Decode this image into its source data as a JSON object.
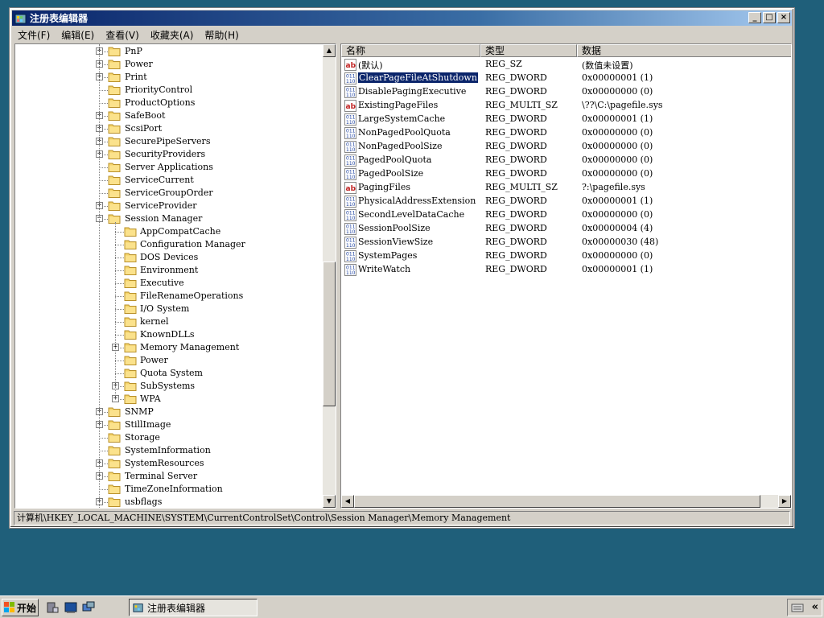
{
  "window": {
    "title": "注册表编辑器"
  },
  "title_buttons": {
    "minimize": "_",
    "maximize": "□",
    "close": "×"
  },
  "menu": [
    "文件(F)",
    "编辑(E)",
    "查看(V)",
    "收藏夹(A)",
    "帮助(H)"
  ],
  "tree": {
    "items": [
      {
        "label": "PnP",
        "expandable": true,
        "level": 0
      },
      {
        "label": "Power",
        "expandable": true,
        "level": 0
      },
      {
        "label": "Print",
        "expandable": true,
        "level": 0
      },
      {
        "label": "PriorityControl",
        "expandable": false,
        "level": 0
      },
      {
        "label": "ProductOptions",
        "expandable": false,
        "level": 0
      },
      {
        "label": "SafeBoot",
        "expandable": true,
        "level": 0
      },
      {
        "label": "ScsiPort",
        "expandable": true,
        "level": 0
      },
      {
        "label": "SecurePipeServers",
        "expandable": true,
        "level": 0
      },
      {
        "label": "SecurityProviders",
        "expandable": true,
        "level": 0
      },
      {
        "label": "Server Applications",
        "expandable": false,
        "level": 0
      },
      {
        "label": "ServiceCurrent",
        "expandable": false,
        "level": 0
      },
      {
        "label": "ServiceGroupOrder",
        "expandable": false,
        "level": 0
      },
      {
        "label": "ServiceProvider",
        "expandable": true,
        "level": 0
      },
      {
        "label": "Session Manager",
        "expandable": true,
        "expanded": true,
        "level": 0
      },
      {
        "label": "AppCompatCache",
        "expandable": false,
        "level": 1
      },
      {
        "label": "Configuration Manager",
        "expandable": false,
        "level": 1
      },
      {
        "label": "DOS Devices",
        "expandable": false,
        "level": 1
      },
      {
        "label": "Environment",
        "expandable": false,
        "level": 1
      },
      {
        "label": "Executive",
        "expandable": false,
        "level": 1
      },
      {
        "label": "FileRenameOperations",
        "expandable": false,
        "level": 1
      },
      {
        "label": "I/O System",
        "expandable": false,
        "level": 1
      },
      {
        "label": "kernel",
        "expandable": false,
        "level": 1
      },
      {
        "label": "KnownDLLs",
        "expandable": false,
        "level": 1
      },
      {
        "label": "Memory Management",
        "expandable": true,
        "level": 1
      },
      {
        "label": "Power",
        "expandable": false,
        "level": 1
      },
      {
        "label": "Quota System",
        "expandable": false,
        "level": 1
      },
      {
        "label": "SubSystems",
        "expandable": true,
        "level": 1
      },
      {
        "label": "WPA",
        "expandable": true,
        "level": 1
      },
      {
        "label": "SNMP",
        "expandable": true,
        "level": 0
      },
      {
        "label": "StillImage",
        "expandable": true,
        "level": 0
      },
      {
        "label": "Storage",
        "expandable": false,
        "level": 0
      },
      {
        "label": "SystemInformation",
        "expandable": false,
        "level": 0
      },
      {
        "label": "SystemResources",
        "expandable": true,
        "level": 0
      },
      {
        "label": "Terminal Server",
        "expandable": true,
        "level": 0
      },
      {
        "label": "TimeZoneInformation",
        "expandable": false,
        "level": 0
      },
      {
        "label": "usbflags",
        "expandable": true,
        "level": 0
      }
    ]
  },
  "values": {
    "columns": [
      "名称",
      "类型",
      "数据"
    ],
    "rows": [
      {
        "icon": "string-icon",
        "name": "(默认)",
        "type": "REG_SZ",
        "data": "(数值未设置)"
      },
      {
        "icon": "binary-icon",
        "name": "ClearPageFileAtShutdown",
        "type": "REG_DWORD",
        "data": "0x00000001 (1)",
        "selected": true
      },
      {
        "icon": "binary-icon",
        "name": "DisablePagingExecutive",
        "type": "REG_DWORD",
        "data": "0x00000000 (0)"
      },
      {
        "icon": "string-icon",
        "name": "ExistingPageFiles",
        "type": "REG_MULTI_SZ",
        "data": "\\??\\C:\\pagefile.sys"
      },
      {
        "icon": "binary-icon",
        "name": "LargeSystemCache",
        "type": "REG_DWORD",
        "data": "0x00000001 (1)"
      },
      {
        "icon": "binary-icon",
        "name": "NonPagedPoolQuota",
        "type": "REG_DWORD",
        "data": "0x00000000 (0)"
      },
      {
        "icon": "binary-icon",
        "name": "NonPagedPoolSize",
        "type": "REG_DWORD",
        "data": "0x00000000 (0)"
      },
      {
        "icon": "binary-icon",
        "name": "PagedPoolQuota",
        "type": "REG_DWORD",
        "data": "0x00000000 (0)"
      },
      {
        "icon": "binary-icon",
        "name": "PagedPoolSize",
        "type": "REG_DWORD",
        "data": "0x00000000 (0)"
      },
      {
        "icon": "string-icon",
        "name": "PagingFiles",
        "type": "REG_MULTI_SZ",
        "data": "?:\\pagefile.sys"
      },
      {
        "icon": "binary-icon",
        "name": "PhysicalAddressExtension",
        "type": "REG_DWORD",
        "data": "0x00000001 (1)"
      },
      {
        "icon": "binary-icon",
        "name": "SecondLevelDataCache",
        "type": "REG_DWORD",
        "data": "0x00000000 (0)"
      },
      {
        "icon": "binary-icon",
        "name": "SessionPoolSize",
        "type": "REG_DWORD",
        "data": "0x00000004 (4)"
      },
      {
        "icon": "binary-icon",
        "name": "SessionViewSize",
        "type": "REG_DWORD",
        "data": "0x00000030 (48)"
      },
      {
        "icon": "binary-icon",
        "name": "SystemPages",
        "type": "REG_DWORD",
        "data": "0x00000000 (0)"
      },
      {
        "icon": "binary-icon",
        "name": "WriteWatch",
        "type": "REG_DWORD",
        "data": "0x00000001 (1)"
      }
    ]
  },
  "statusbar": {
    "path": "计算机\\HKEY_LOCAL_MACHINE\\SYSTEM\\CurrentControlSet\\Control\\Session Manager\\Memory Management"
  },
  "taskbar": {
    "start_label": "开始",
    "task_label": "注册表编辑器",
    "tray_arrow": "«"
  },
  "colors": {
    "desktop": "#1f5f7a",
    "title_active": "#0a246a",
    "selection": "#0a246a"
  }
}
